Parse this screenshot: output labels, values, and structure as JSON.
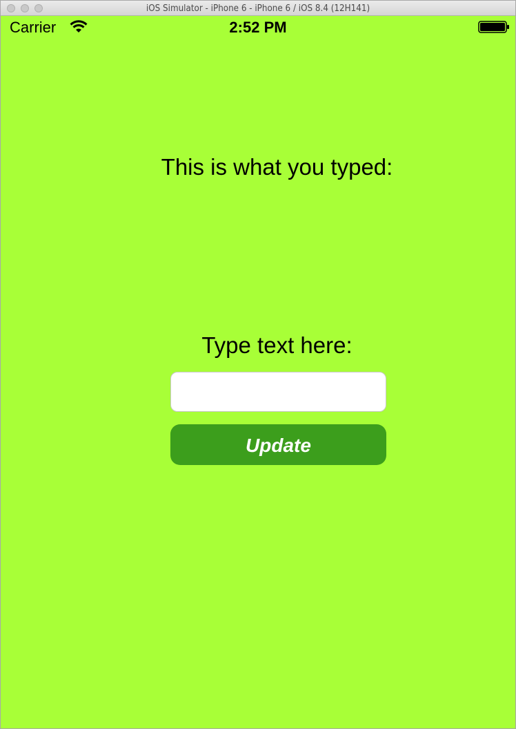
{
  "window": {
    "title": "iOS Simulator - iPhone 6 - iPhone 6 / iOS 8.4 (12H141)"
  },
  "statusbar": {
    "carrier": "Carrier",
    "time": "2:52 PM",
    "wifi_icon": "wifi-icon",
    "battery_icon": "battery-icon"
  },
  "main": {
    "output_label": "This is what you typed:",
    "input_label": "Type text here:",
    "text_field_value": "",
    "text_field_placeholder": "",
    "update_button_label": "Update"
  },
  "colors": {
    "background": "#a8ff37",
    "button": "#3c9e1c",
    "button_text": "#ffffff",
    "field_background": "#ffffff"
  }
}
